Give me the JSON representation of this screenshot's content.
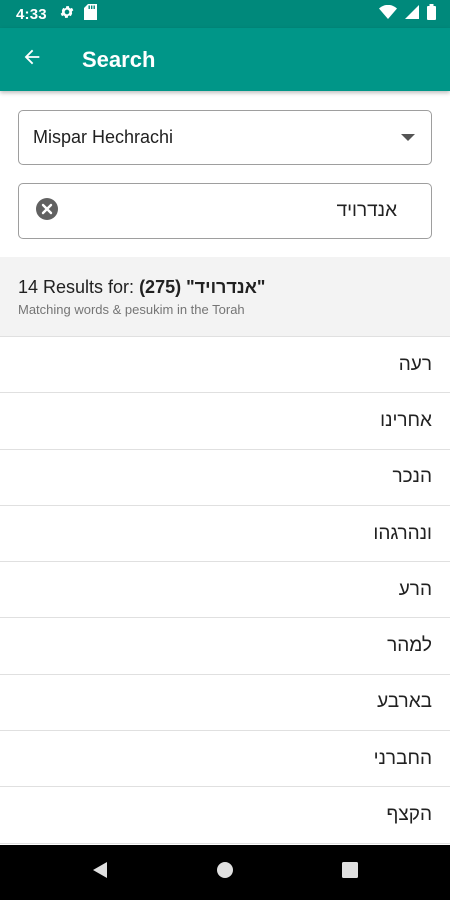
{
  "status_bar": {
    "time": "4:33",
    "icons": [
      "settings-icon",
      "sd-card-icon",
      "wifi-icon",
      "signal-icon",
      "battery-icon"
    ]
  },
  "app_bar": {
    "back_icon": "arrow-left-icon",
    "title": "Search"
  },
  "method_select": {
    "value": "Mispar Hechrachi"
  },
  "search": {
    "value": "אנדרויד",
    "clear_icon": "clear-circle-icon"
  },
  "results_header": {
    "prefix": "14 Results for: ",
    "value": "(275)",
    "query": "\"אנדרויד\"",
    "subtitle": "Matching words & pesukim in the Torah"
  },
  "results": [
    "רעה",
    "אחרינו",
    "הנכר",
    "ונהרגהו",
    "הרע",
    "למהר",
    "בארבע",
    "החברני",
    "הקצף"
  ],
  "nav_bar": {
    "icons": [
      "back-triangle-icon",
      "home-circle-icon",
      "recents-square-icon"
    ]
  },
  "colors": {
    "status_bar": "#00897b",
    "app_bar": "#009688",
    "header_bg": "#f3f3f3"
  }
}
